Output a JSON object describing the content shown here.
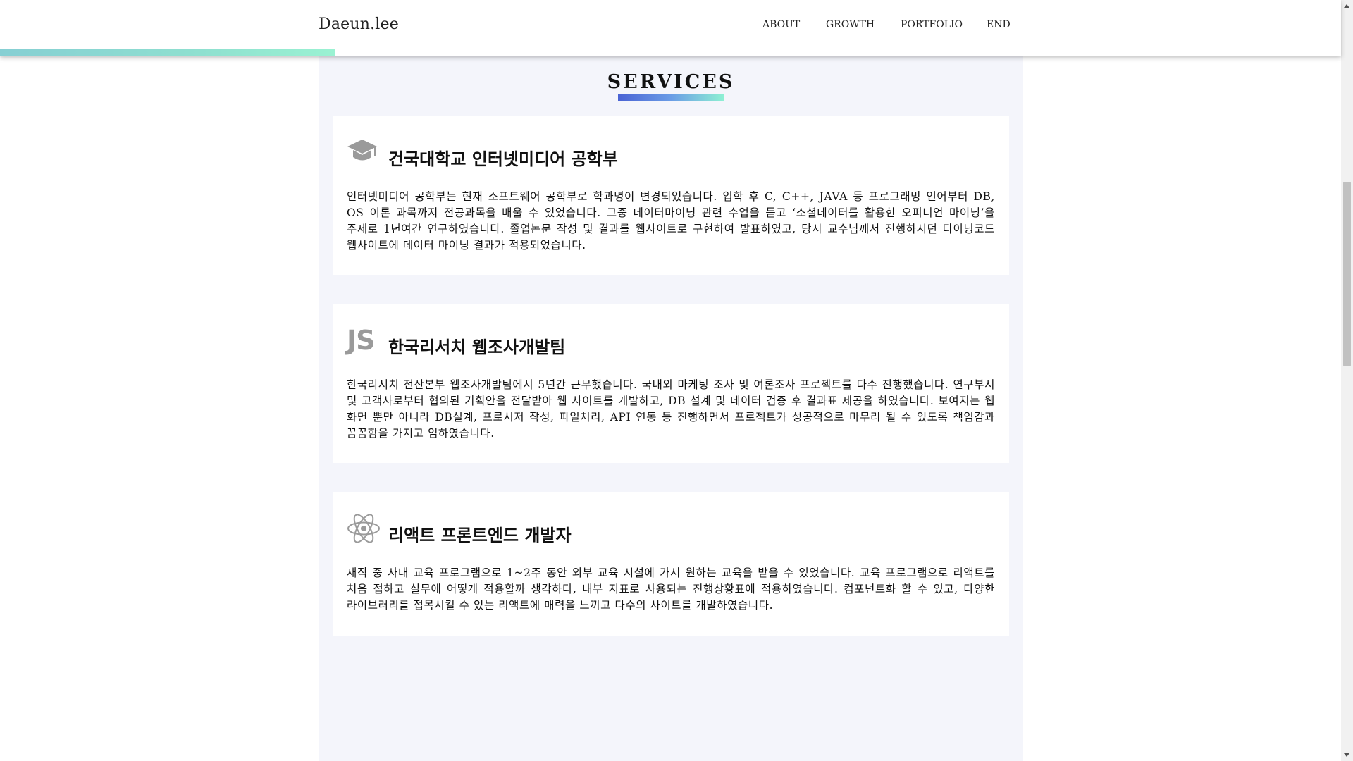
{
  "header": {
    "brand": "Daeun.lee",
    "nav": [
      {
        "label": "ABOUT"
      },
      {
        "label": "GROWTH"
      },
      {
        "label": "PORTFOLIO"
      },
      {
        "label": "END"
      }
    ],
    "scroll_progress_percent": 25
  },
  "section": {
    "title": "SERVICES"
  },
  "cards": [
    {
      "icon": "graduation-cap-icon",
      "title": "건국대학교 인터넷미디어 공학부",
      "body": "인터넷미디어 공학부는 현재 소프트웨어 공학부로 학과명이 변경되었습니다. 입학 후 C, C++, JAVA 등 프로그래밍 언어부터 DB, OS 이론 과목까지 전공과목을 배울 수 있었습니다. 그중 데이터마이닝 관련 수업을 듣고 ‘소셜데이터를 활용한 오피니언 마이닝’을 주제로 1년여간 연구하였습니다. 졸업논문 작성 및 결과를 웹사이트로 구현하여 발표하였고, 당시 교수님께서 진행하시던 다이닝코드 웹사이트에 데이터 마이닝 결과가 적용되었습니다."
    },
    {
      "icon": "javascript-icon",
      "icon_text": "JS",
      "title": "한국리서치 웹조사개발팀",
      "body": "한국리서치 전산본부 웹조사개발팀에서 5년간 근무했습니다. 국내외 마케팅 조사 및 여론조사 프로젝트를 다수 진행했습니다. 연구부서 및 고객사로부터 협의된 기획안을 전달받아 웹 사이트를 개발하고, DB 설계 및 데이터 검증 후 결과표 제공을 하였습니다. 보여지는 웹 화면 뿐만 아니라 DB설계, 프로시저 작성, 파일처리, API 연동 등 진행하면서 프로젝트가 성공적으로 마무리 될 수 있도록 책임감과 꼼꼼함을 가지고 임하였습니다."
    },
    {
      "icon": "react-icon",
      "title": "리액트 프론트엔드 개발자",
      "body": "재직 중 사내 교육 프로그램으로 1~2주 동안 외부 교육 시설에 가서 원하는 교육을 받을 수 있었습니다. 교육 프로그램으로 리액트를 처음 접하고 실무에 어떻게 적용할까 생각하다, 내부 지표로 사용되는 진행상황표에 적용하였습니다. 컴포넌트화 할 수 있고, 다양한 라이브러리를 접목시킬 수 있는 리액트에 매력을 느끼고 다수의 사이트를 개발하였습니다."
    }
  ],
  "colors": {
    "content_bg": "#f4f5fb",
    "progress_gradient_start": "#86cfd3",
    "progress_gradient_end": "#9af2d2",
    "underline_start": "#4a63d4",
    "underline_end": "#8ef0d3",
    "icon_gray": "#9a9a9a"
  }
}
